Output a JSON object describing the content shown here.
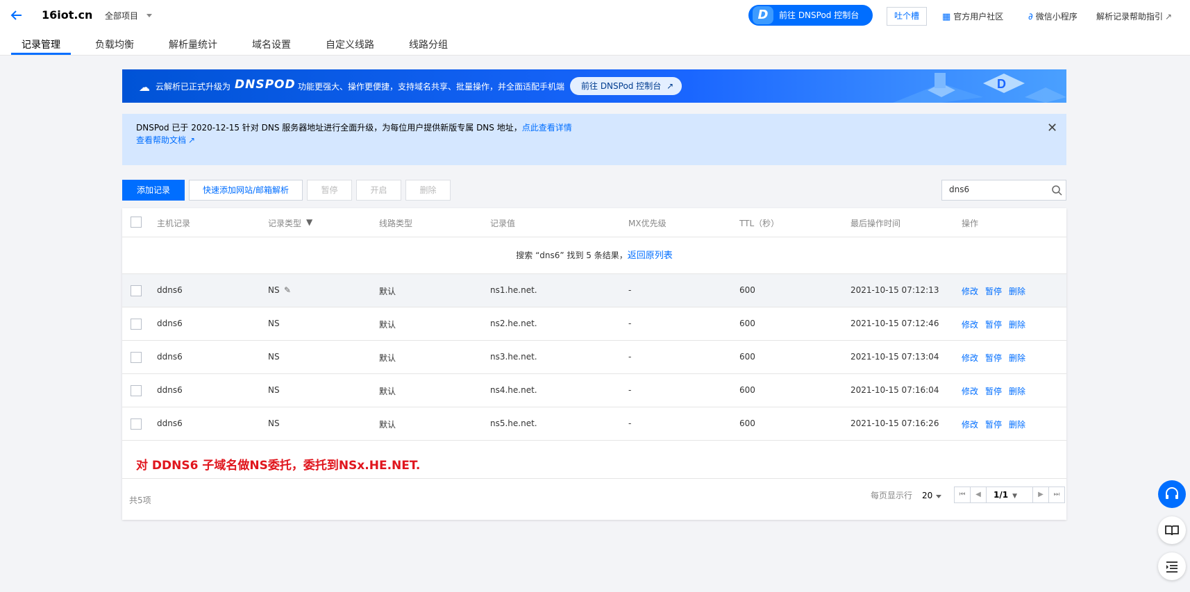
{
  "header": {
    "domain": "16iot.cn",
    "project": "全部项目",
    "console_button": "前往 DNSPod 控制台",
    "console_logo": "D",
    "feedback": "吐个槽",
    "community": "官方用户社区",
    "miniprogram": "微信小程序",
    "help": "解析记录帮助指引"
  },
  "tabs": [
    "记录管理",
    "负载均衡",
    "解析量统计",
    "域名设置",
    "自定义线路",
    "线路分组"
  ],
  "banner": {
    "text1": "云解析已正式升级为",
    "logo": "DNSPOD",
    "text2": "功能更强大、操作更便捷，支持域名共享、批量操作，并全面适配手机端",
    "button": "前往 DNSPod 控制台"
  },
  "notice": {
    "text": "DNSPod 已于 2020-12-15 针对 DNS 服务器地址进行全面升级，为每位用户提供新版专属 DNS 地址，",
    "link": "点此查看详情",
    "help": "查看帮助文档"
  },
  "toolbar": {
    "add": "添加记录",
    "quick_add": "快速添加网站/邮箱解析",
    "pause": "暂停",
    "enable": "开启",
    "delete": "删除",
    "search_value": "dns6"
  },
  "table": {
    "columns": [
      "主机记录",
      "记录类型",
      "线路类型",
      "记录值",
      "MX优先级",
      "TTL（秒）",
      "最后操作时间",
      "操作"
    ],
    "search_result": "搜索 “dns6” 找到 5 条结果，",
    "back_link": "返回原列表",
    "rows": [
      {
        "host": "ddns6",
        "type": "NS",
        "line": "默认",
        "value": "ns1.he.net.",
        "mx": "-",
        "ttl": "600",
        "time": "2021-10-15 07:12:13"
      },
      {
        "host": "ddns6",
        "type": "NS",
        "line": "默认",
        "value": "ns2.he.net.",
        "mx": "-",
        "ttl": "600",
        "time": "2021-10-15 07:12:46"
      },
      {
        "host": "ddns6",
        "type": "NS",
        "line": "默认",
        "value": "ns3.he.net.",
        "mx": "-",
        "ttl": "600",
        "time": "2021-10-15 07:13:04"
      },
      {
        "host": "ddns6",
        "type": "NS",
        "line": "默认",
        "value": "ns4.he.net.",
        "mx": "-",
        "ttl": "600",
        "time": "2021-10-15 07:16:04"
      },
      {
        "host": "ddns6",
        "type": "NS",
        "line": "默认",
        "value": "ns5.he.net.",
        "mx": "-",
        "ttl": "600",
        "time": "2021-10-15 07:16:26"
      }
    ],
    "actions": {
      "edit": "修改",
      "pause": "暂停",
      "delete": "删除"
    },
    "annotation": "对 DDNS6 子域名做NS委托，委托到NSx.HE.NET.",
    "total": "共5项",
    "per_page_label": "每页显示行",
    "per_page": "20",
    "page": "1/1"
  },
  "colors": {
    "accent": "#006eff",
    "annotation": "#e0151d",
    "notice_bg": "#d5e7ff"
  }
}
